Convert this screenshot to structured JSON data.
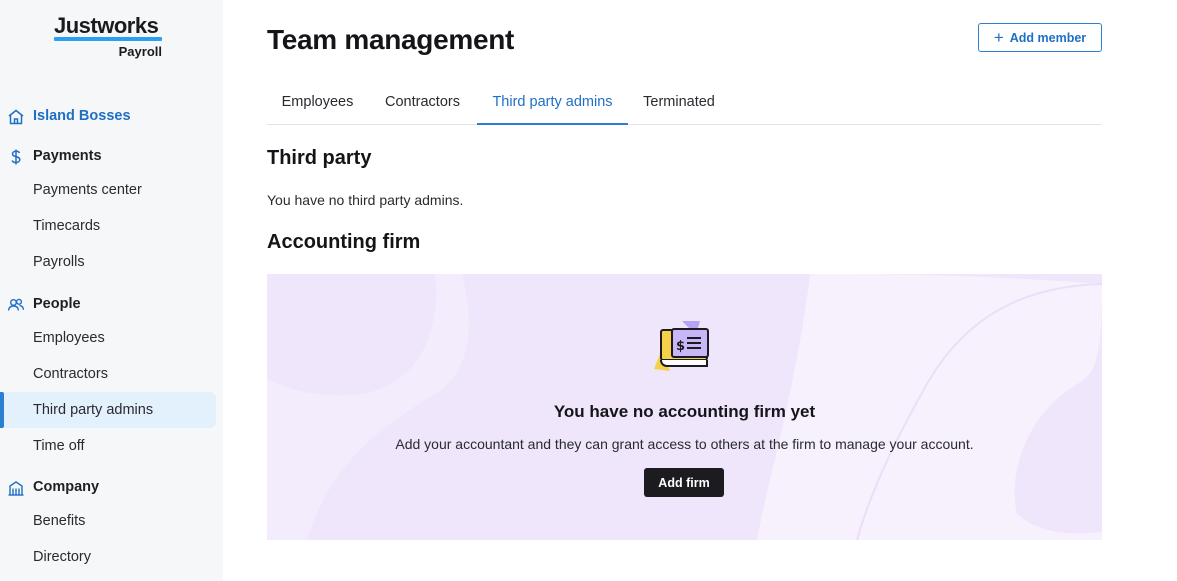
{
  "brand": {
    "name": "Justworks",
    "product": "Payroll"
  },
  "sidebar": {
    "company_name": "Island Bosses",
    "sections": [
      {
        "label": "Payments",
        "icon": "dollar-icon",
        "items": [
          "Payments center",
          "Timecards",
          "Payrolls"
        ]
      },
      {
        "label": "People",
        "icon": "people-icon",
        "items": [
          "Employees",
          "Contractors",
          "Third party admins",
          "Time off"
        ]
      },
      {
        "label": "Company",
        "icon": "building-icon",
        "items": [
          "Benefits",
          "Directory"
        ]
      }
    ],
    "active_item": "Third party admins"
  },
  "header": {
    "title": "Team management",
    "add_member_label": "Add member"
  },
  "tabs": [
    {
      "label": "Employees"
    },
    {
      "label": "Contractors"
    },
    {
      "label": "Third party admins",
      "active": true
    },
    {
      "label": "Terminated"
    }
  ],
  "third_party": {
    "heading": "Third party",
    "empty_text": "You have no third party admins."
  },
  "accounting": {
    "heading": "Accounting firm",
    "empty_title": "You have no accounting firm yet",
    "empty_desc": "Add your accountant and they can grant access to others at the firm to manage your account.",
    "add_firm_label": "Add firm"
  },
  "colors": {
    "accent": "#1f6fc5",
    "active_bg": "#e3f1fd",
    "card_bg": "#efe6fb",
    "dark_button": "#1c1c20"
  }
}
